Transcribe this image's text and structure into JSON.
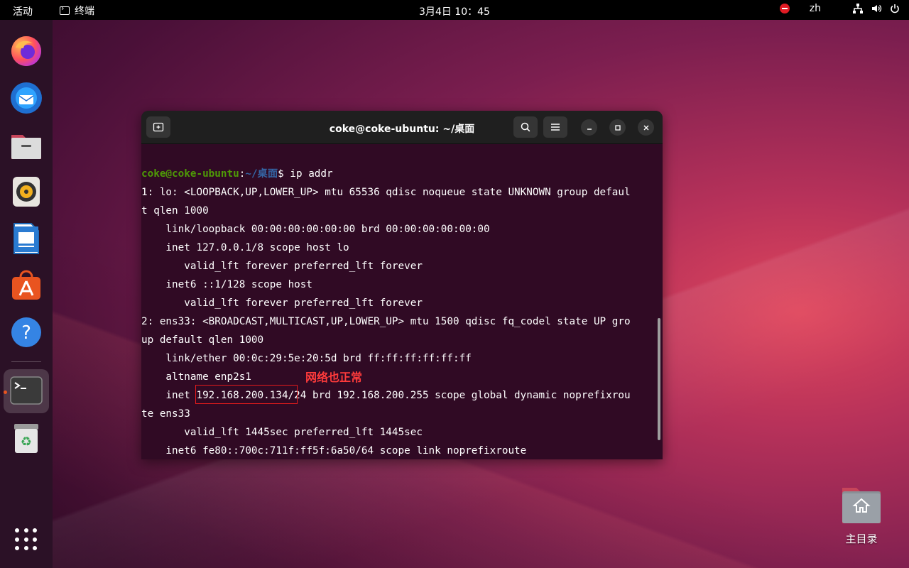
{
  "topbar": {
    "activities": "活动",
    "app_name": "终端",
    "clock": "3月4日  10：45",
    "language": "zh",
    "icons": [
      "do-not-disturb-icon",
      "network-icon",
      "volume-icon",
      "power-icon"
    ]
  },
  "dock": {
    "items": [
      {
        "name": "Firefox",
        "icon": "firefox-icon"
      },
      {
        "name": "Thunderbird",
        "icon": "thunderbird-icon"
      },
      {
        "name": "Files",
        "icon": "files-icon"
      },
      {
        "name": "Rhythmbox",
        "icon": "rhythmbox-icon"
      },
      {
        "name": "LibreOffice Writer",
        "icon": "writer-icon"
      },
      {
        "name": "Ubuntu Software",
        "icon": "software-icon"
      },
      {
        "name": "Help",
        "icon": "help-icon"
      },
      {
        "name": "Terminal",
        "icon": "terminal-icon",
        "active": true
      },
      {
        "name": "Trash",
        "icon": "trash-icon"
      },
      {
        "name": "Show Applications",
        "icon": "app-grid-icon"
      }
    ]
  },
  "terminal": {
    "title": "coke@coke-ubuntu: ~/桌面",
    "prompt": {
      "user_host": "coke@coke-ubuntu",
      "sep": ":",
      "path": "~/桌面",
      "symbol": "$ ",
      "command": "ip addr"
    },
    "lines": [
      "1: lo: <LOOPBACK,UP,LOWER_UP> mtu 65536 qdisc noqueue state UNKNOWN group defaul",
      "t qlen 1000",
      "    link/loopback 00:00:00:00:00:00 brd 00:00:00:00:00:00",
      "    inet 127.0.0.1/8 scope host lo",
      "       valid_lft forever preferred_lft forever",
      "    inet6 ::1/128 scope host ",
      "       valid_lft forever preferred_lft forever",
      "2: ens33: <BROADCAST,MULTICAST,UP,LOWER_UP> mtu 1500 qdisc fq_codel state UP gro",
      "up default qlen 1000",
      "    link/ether 00:0c:29:5e:20:5d brd ff:ff:ff:ff:ff:ff",
      "    altname enp2s1",
      "    inet 192.168.200.134/24 brd 192.168.200.255 scope global dynamic noprefixrou",
      "te ens33",
      "       valid_lft 1445sec preferred_lft 1445sec",
      "    inet6 fe80::700c:711f:ff5f:6a50/64 scope link noprefixroute "
    ],
    "annotation": "网络也正常"
  },
  "desktop": {
    "home_label": "主目录"
  },
  "colors": {
    "terminal_bg": "#300a24",
    "prompt_user": "#4e9a06",
    "prompt_path": "#3465a4",
    "annotation": "#ff3b3b",
    "accent": "#e95420"
  }
}
